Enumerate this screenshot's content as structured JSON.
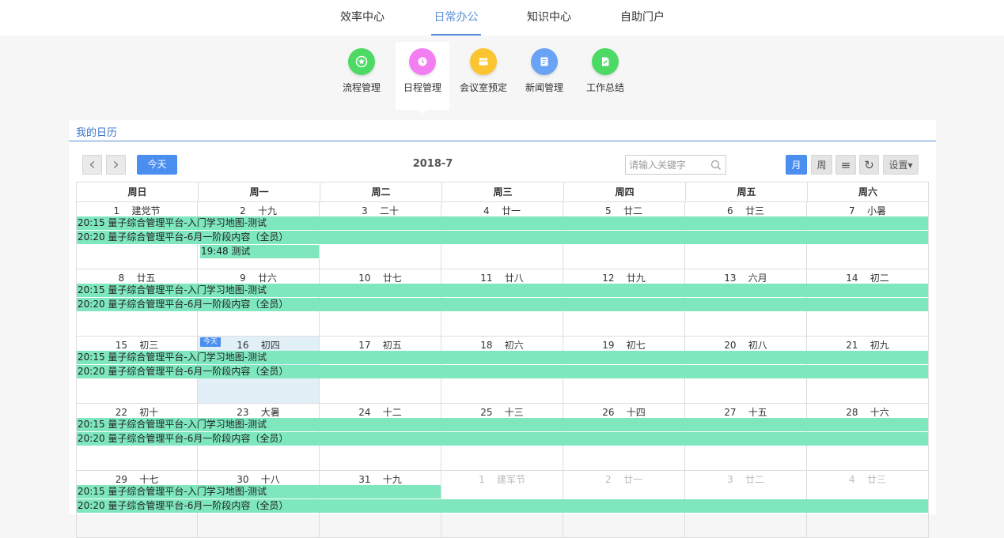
{
  "top_nav": {
    "tabs": [
      {
        "label": "效率中心",
        "active": false
      },
      {
        "label": "日常办公",
        "active": true
      },
      {
        "label": "知识中心",
        "active": false
      },
      {
        "label": "自助门户",
        "active": false
      }
    ]
  },
  "apps": [
    {
      "label": "流程管理",
      "icon": "star-badge-icon",
      "color": "#4cd964",
      "active": false
    },
    {
      "label": "日程管理",
      "icon": "clock-icon",
      "color": "#f27ef2",
      "active": true
    },
    {
      "label": "会议室预定",
      "icon": "meeting-people-icon",
      "color": "#fbc532",
      "active": false
    },
    {
      "label": "新闻管理",
      "icon": "news-doc-icon",
      "color": "#6aa3f5",
      "active": false
    },
    {
      "label": "工作总结",
      "icon": "edit-doc-icon",
      "color": "#4cd964",
      "active": false
    }
  ],
  "panel": {
    "title": "我的日历"
  },
  "toolbar": {
    "prev": "‹",
    "next": "›",
    "today_label": "今天",
    "title": "2018-7",
    "search_placeholder": "请输入关键字",
    "view_month": "月",
    "view_week": "周",
    "view_list": "≡",
    "refresh": "↻",
    "settings": "设置▾"
  },
  "colors": {
    "accent": "#4a8ef0",
    "event": "#7ee7be",
    "today_bg": "#e1f0f7"
  },
  "calendar": {
    "weekdays": [
      "周日",
      "周一",
      "周二",
      "周三",
      "周四",
      "周五",
      "周六"
    ],
    "today_tag": "今天",
    "weeks": [
      {
        "days": [
          {
            "d": "1",
            "lunar": "建党节"
          },
          {
            "d": "2",
            "lunar": "十九"
          },
          {
            "d": "3",
            "lunar": "二十"
          },
          {
            "d": "4",
            "lunar": "廿一"
          },
          {
            "d": "5",
            "lunar": "廿二"
          },
          {
            "d": "6",
            "lunar": "廿三"
          },
          {
            "d": "7",
            "lunar": "小暑"
          }
        ],
        "events": [
          {
            "text": "20:15 量子综合管理平台-入门学习地图-测试",
            "start": 0,
            "end": 6,
            "row": 0
          },
          {
            "text": "20:20 量子综合管理平台-6月一阶段内容（全员）",
            "start": 0,
            "end": 6,
            "row": 1
          },
          {
            "text": "19:48 测试",
            "start": 1,
            "end": 1,
            "row": 2
          }
        ]
      },
      {
        "days": [
          {
            "d": "8",
            "lunar": "廿五"
          },
          {
            "d": "9",
            "lunar": "廿六"
          },
          {
            "d": "10",
            "lunar": "廿七"
          },
          {
            "d": "11",
            "lunar": "廿八"
          },
          {
            "d": "12",
            "lunar": "廿九"
          },
          {
            "d": "13",
            "lunar": "六月"
          },
          {
            "d": "14",
            "lunar": "初二"
          }
        ],
        "events": [
          {
            "text": "20:15 量子综合管理平台-入门学习地图-测试",
            "start": 0,
            "end": 6,
            "row": 0
          },
          {
            "text": "20:20 量子综合管理平台-6月一阶段内容（全员）",
            "start": 0,
            "end": 6,
            "row": 1
          }
        ]
      },
      {
        "days": [
          {
            "d": "15",
            "lunar": "初三"
          },
          {
            "d": "16",
            "lunar": "初四",
            "today": true
          },
          {
            "d": "17",
            "lunar": "初五"
          },
          {
            "d": "18",
            "lunar": "初六"
          },
          {
            "d": "19",
            "lunar": "初七"
          },
          {
            "d": "20",
            "lunar": "初八"
          },
          {
            "d": "21",
            "lunar": "初九"
          }
        ],
        "events": [
          {
            "text": "20:15 量子综合管理平台-入门学习地图-测试",
            "start": 0,
            "end": 6,
            "row": 0
          },
          {
            "text": "20:20 量子综合管理平台-6月一阶段内容（全员）",
            "start": 0,
            "end": 6,
            "row": 1
          }
        ]
      },
      {
        "days": [
          {
            "d": "22",
            "lunar": "初十"
          },
          {
            "d": "23",
            "lunar": "大暑"
          },
          {
            "d": "24",
            "lunar": "十二"
          },
          {
            "d": "25",
            "lunar": "十三"
          },
          {
            "d": "26",
            "lunar": "十四"
          },
          {
            "d": "27",
            "lunar": "十五"
          },
          {
            "d": "28",
            "lunar": "十六"
          }
        ],
        "events": [
          {
            "text": "20:15 量子综合管理平台-入门学习地图-测试",
            "start": 0,
            "end": 6,
            "row": 0
          },
          {
            "text": "20:20 量子综合管理平台-6月一阶段内容（全员）",
            "start": 0,
            "end": 6,
            "row": 1
          }
        ]
      },
      {
        "days": [
          {
            "d": "29",
            "lunar": "十七"
          },
          {
            "d": "30",
            "lunar": "十八"
          },
          {
            "d": "31",
            "lunar": "十九"
          },
          {
            "d": "1",
            "lunar": "建军节",
            "other": true
          },
          {
            "d": "2",
            "lunar": "廿一",
            "other": true
          },
          {
            "d": "3",
            "lunar": "廿二",
            "other": true
          },
          {
            "d": "4",
            "lunar": "廿三",
            "other": true
          }
        ],
        "events": [
          {
            "text": "20:15 量子综合管理平台-入门学习地图-测试",
            "start": 0,
            "end": 2,
            "row": 0
          },
          {
            "text": "20:20 量子综合管理平台-6月一阶段内容（全员）",
            "start": 0,
            "end": 6,
            "row": 1
          }
        ]
      }
    ]
  }
}
